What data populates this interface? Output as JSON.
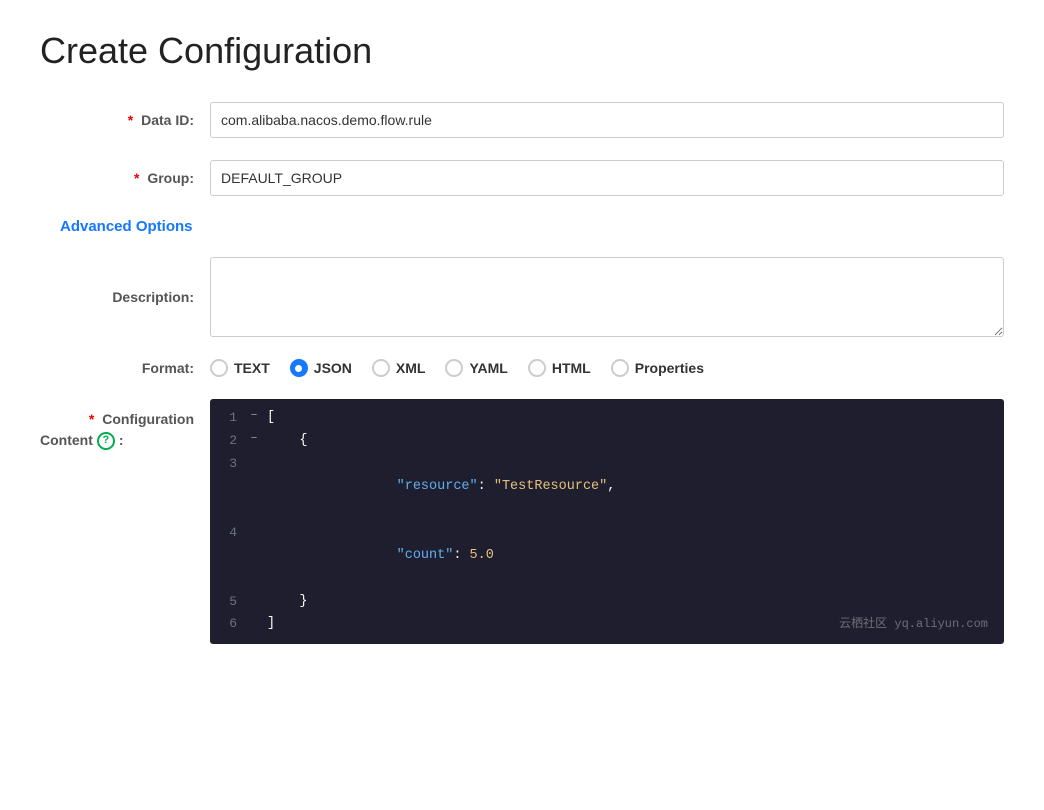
{
  "page": {
    "title": "Create Configuration"
  },
  "form": {
    "data_id_label": "Data ID:",
    "data_id_value": "com.alibaba.nacos.demo.flow.rule",
    "group_label": "Group:",
    "group_value": "DEFAULT_GROUP",
    "advanced_options_label": "Advanced Options",
    "description_label": "Description:",
    "description_value": "",
    "format_label": "Format:",
    "format_options": [
      {
        "value": "TEXT",
        "selected": false
      },
      {
        "value": "JSON",
        "selected": true
      },
      {
        "value": "XML",
        "selected": false
      },
      {
        "value": "YAML",
        "selected": false
      },
      {
        "value": "HTML",
        "selected": false
      },
      {
        "value": "Properties",
        "selected": false
      }
    ],
    "config_label_line1": "* Configuration",
    "config_label_line2": "Content",
    "help_icon_label": "?",
    "required_star": "*"
  },
  "code": {
    "lines": [
      {
        "num": 1,
        "fold": "−",
        "content": "[",
        "class": "bracket"
      },
      {
        "num": 2,
        "fold": "−",
        "content": "    {",
        "class": "bracket"
      },
      {
        "num": 3,
        "fold": "",
        "content": null,
        "key": "\"resource\"",
        "colon": ": ",
        "val": "\"TestResource\"",
        "comma": ","
      },
      {
        "num": 4,
        "fold": "",
        "content": null,
        "key": "\"count\"",
        "colon": ": ",
        "num_val": "5.0"
      },
      {
        "num": 5,
        "fold": "",
        "content": "    }",
        "class": "bracket"
      },
      {
        "num": 6,
        "fold": "",
        "content": "]",
        "class": "bracket"
      }
    ],
    "watermark": "云栖社区 yq.aliyun.com"
  }
}
